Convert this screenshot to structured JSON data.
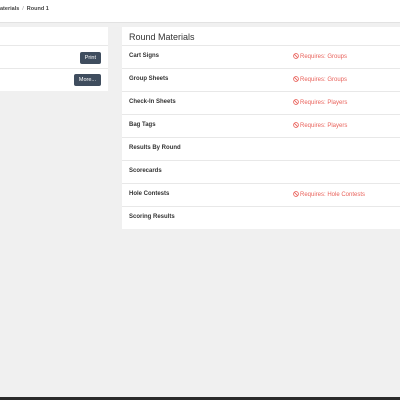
{
  "breadcrumb": {
    "items": [
      "aterials",
      "Round 1"
    ],
    "separator": "/"
  },
  "left_panel": {
    "print_label": "Print",
    "more_label": "More..."
  },
  "round_materials": {
    "title": "Round Materials",
    "items": [
      {
        "name": "Cart Signs",
        "requirement": "Requires: Groups"
      },
      {
        "name": "Group Sheets",
        "requirement": "Requires: Groups"
      },
      {
        "name": "Check-In Sheets",
        "requirement": "Requires: Players"
      },
      {
        "name": "Bag Tags",
        "requirement": "Requires: Players"
      },
      {
        "name": "Results By Round",
        "requirement": ""
      },
      {
        "name": "Scorecards",
        "requirement": ""
      },
      {
        "name": "Hole Contests",
        "requirement": "Requires: Hole Contests"
      },
      {
        "name": "Scoring Results",
        "requirement": ""
      }
    ]
  },
  "colors": {
    "requirement_text": "#e9625b",
    "button_bg": "#3f4d5e",
    "page_bg": "#f0f0f0"
  },
  "icons": {
    "requirement": "ban-icon"
  }
}
